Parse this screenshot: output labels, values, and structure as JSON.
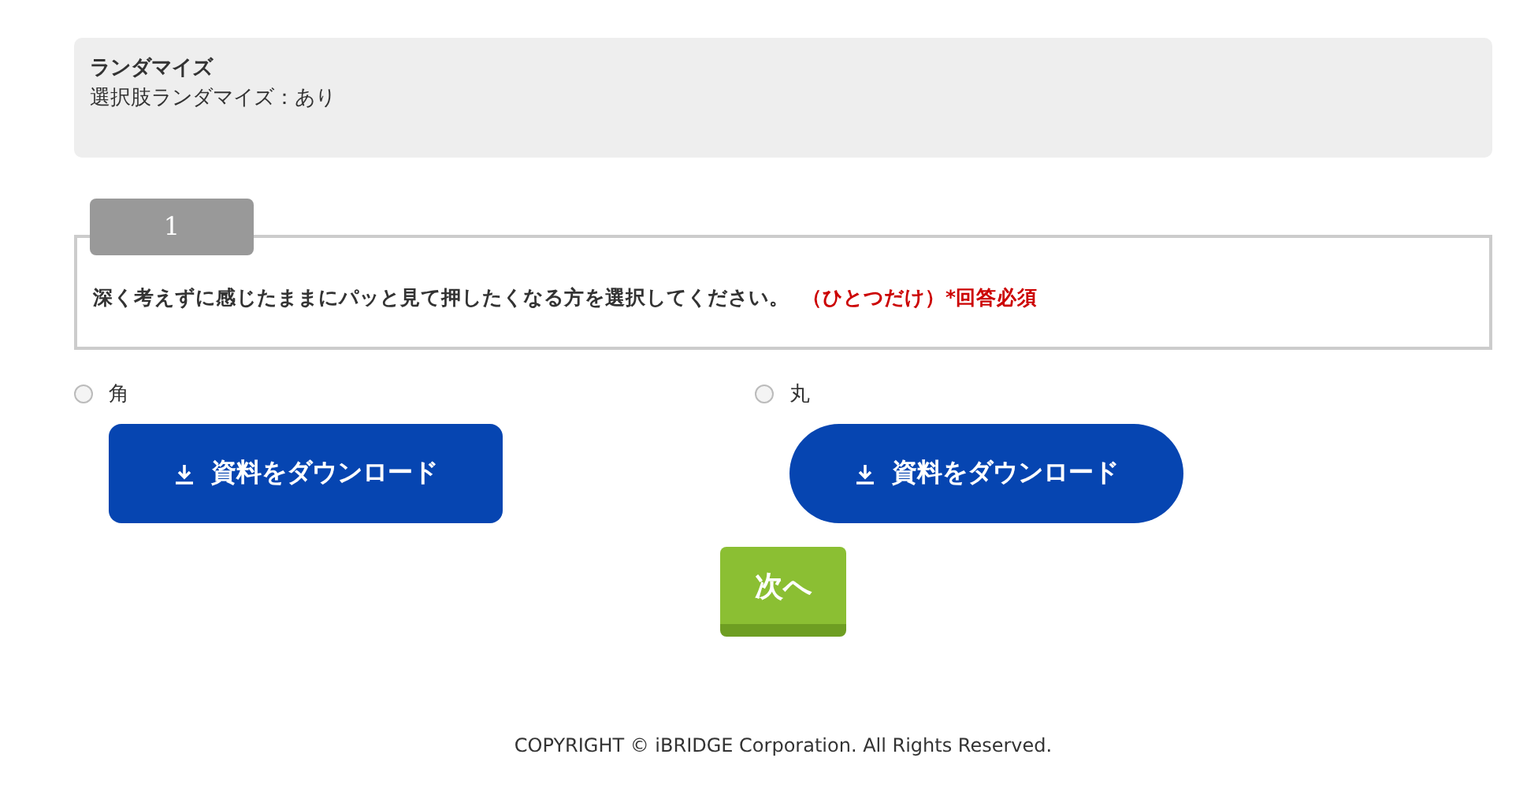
{
  "info": {
    "title": "ランダマイズ",
    "text": "選択肢ランダマイズ：あり"
  },
  "question": {
    "number": "1",
    "text": "深く考えずに感じたままにパッと見て押したくなる方を選択してください。",
    "note": "（ひとつだけ）*回答必須"
  },
  "options": [
    {
      "label": "角",
      "selected": false,
      "kind": "square",
      "button": "資料をダウンロード"
    },
    {
      "label": "丸",
      "selected": false,
      "kind": "round",
      "button": "資料をダウンロード"
    }
  ],
  "next_button": "次へ",
  "footer": "COPYRIGHT © iBRIDGE Corporation. All Rights Reserved."
}
